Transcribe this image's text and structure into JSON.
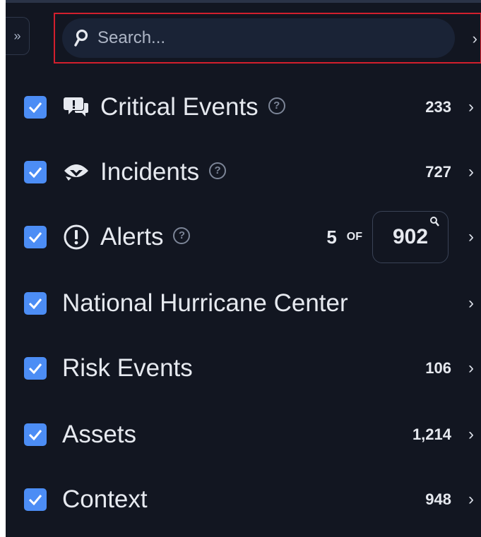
{
  "sidebar": {
    "collapse_glyph": "»",
    "search": {
      "placeholder": "Search...",
      "chevron": "›"
    },
    "items": [
      {
        "label": "Critical Events",
        "icon": "chat-alert-icon",
        "has_help": true,
        "count": "233",
        "checked": true
      },
      {
        "label": "Incidents",
        "icon": "incident-eye-icon",
        "has_help": true,
        "count": "727",
        "checked": true
      },
      {
        "label": "Alerts",
        "icon": "exclamation-circle-icon",
        "has_help": true,
        "shown": "5",
        "of_word": "OF",
        "total": "902",
        "checked": true
      },
      {
        "label": "National Hurricane Center",
        "icon": "",
        "has_help": false,
        "count": "",
        "checked": true
      },
      {
        "label": "Risk Events",
        "icon": "",
        "has_help": false,
        "count": "106",
        "checked": true
      },
      {
        "label": "Assets",
        "icon": "",
        "has_help": false,
        "count": "1,214",
        "checked": true
      },
      {
        "label": "Context",
        "icon": "",
        "has_help": false,
        "count": "948",
        "checked": true
      }
    ],
    "help_glyph": "?",
    "chevron": "›"
  },
  "colors": {
    "background": "#121621",
    "checkbox": "#4c8df5",
    "highlight": "#d21f2d",
    "search_bg": "#1a2336"
  }
}
